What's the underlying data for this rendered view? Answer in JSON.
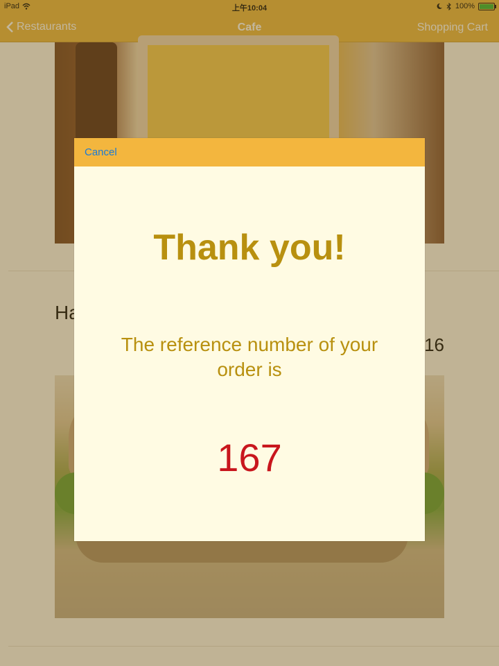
{
  "status_bar": {
    "device": "iPad",
    "time": "上午10:04",
    "battery": "100%"
  },
  "nav": {
    "back_label": "Restaurants",
    "title": "Cafe",
    "right_label": "Shopping Cart"
  },
  "list": {
    "item_title_partial": "Ha",
    "item_price_partial": "16"
  },
  "modal": {
    "cancel_label": "Cancel",
    "title": "Thank you!",
    "message": "The reference number of your order is",
    "reference_number": "167"
  },
  "colors": {
    "accent": "#e9b43a",
    "modal_header": "#f3b63e",
    "modal_bg": "#fffbe3",
    "title_text": "#b8900f",
    "reference_number": "#c8161d",
    "link": "#1a7bd6"
  },
  "icons": [
    "wifi-icon",
    "moon-icon",
    "bluetooth-icon",
    "battery-icon",
    "chevron-left-icon"
  ]
}
